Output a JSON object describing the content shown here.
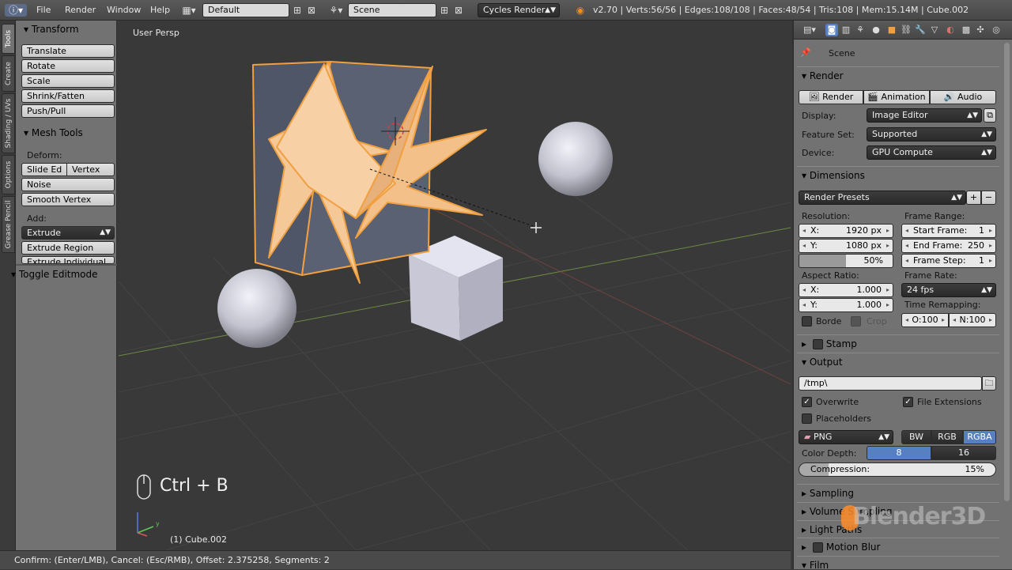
{
  "topbar": {
    "menus": [
      "File",
      "Render",
      "Window",
      "Help"
    ],
    "screen_layout": "Default",
    "scene": "Scene",
    "render_engine": "Cycles Render",
    "stats": "v2.70 | Verts:56/56 | Edges:108/108 | Faces:48/54 | Tris:108 | Mem:15.14M | Cube.002"
  },
  "left_tabs": [
    "Tools",
    "Create",
    "Shading / UVs",
    "Options",
    "Grease Pencil"
  ],
  "tools": {
    "transform_header": "Transform",
    "transform_buttons": [
      "Translate",
      "Rotate",
      "Scale",
      "Shrink/Fatten",
      "Push/Pull"
    ],
    "mesh_tools_header": "Mesh Tools",
    "deform_label": "Deform:",
    "slide_edge": "Slide Ed",
    "vertex": "Vertex",
    "noise": "Noise",
    "smooth_vertex": "Smooth Vertex",
    "add_label": "Add:",
    "extrude": "Extrude",
    "extrude_region": "Extrude Region",
    "extrude_individual": "Extrude Individual",
    "toggle_editmode": "Toggle Editmode"
  },
  "viewport": {
    "view_name": "User Persp",
    "shortcut": "Ctrl + B",
    "object_label": "(1) Cube.002",
    "axis_y": "y",
    "axis_x": "x"
  },
  "statusbar": {
    "text": "Confirm: (Enter/LMB), Cancel: (Esc/RMB), Offset: 2.375258, Segments: 2"
  },
  "props": {
    "context": "Scene",
    "render": {
      "header": "Render",
      "tabs": [
        "Render",
        "Animation",
        "Audio"
      ],
      "display_label": "Display:",
      "display_value": "Image Editor",
      "feature_label": "Feature Set:",
      "feature_value": "Supported",
      "device_label": "Device:",
      "device_value": "GPU Compute"
    },
    "dimensions": {
      "header": "Dimensions",
      "presets": "Render Presets",
      "resolution_label": "Resolution:",
      "res_x_key": "X:",
      "res_x": "1920 px",
      "res_y_key": "Y:",
      "res_y": "1080 px",
      "res_pct": "50%",
      "frame_range_label": "Frame Range:",
      "start_key": "Start Frame:",
      "start": "1",
      "end_key": "End Frame:",
      "end": "250",
      "step_key": "Frame Step:",
      "step": "1",
      "aspect_label": "Aspect Ratio:",
      "asp_x_key": "X:",
      "asp_x": "1.000",
      "asp_y_key": "Y:",
      "asp_y": "1.000",
      "frame_rate_label": "Frame Rate:",
      "frame_rate": "24 fps",
      "time_remap_label": "Time Remapping:",
      "remap_old": "O:100",
      "remap_new": "N:100",
      "border": "Borde",
      "crop": "Crop"
    },
    "stamp": "Stamp",
    "output": {
      "header": "Output",
      "path": "/tmp\\",
      "overwrite": "Overwrite",
      "file_ext": "File Extensions",
      "placeholders": "Placeholders",
      "format": "PNG",
      "bw": "BW",
      "rgb": "RGB",
      "rgba": "RGBA",
      "color_depth_label": "Color Depth:",
      "depth_8": "8",
      "depth_16": "16",
      "compression_label": "Compression:",
      "compression": "15%"
    },
    "collapsed": [
      "Sampling",
      "Volume Sampling",
      "Light Paths",
      "Motion Blur",
      "Film"
    ]
  },
  "watermark": "Blender3D",
  "colors": {
    "accent_blue": "#5680c2",
    "selection_orange": "#f0a040",
    "bg": "#393939",
    "panel": "#727272"
  }
}
